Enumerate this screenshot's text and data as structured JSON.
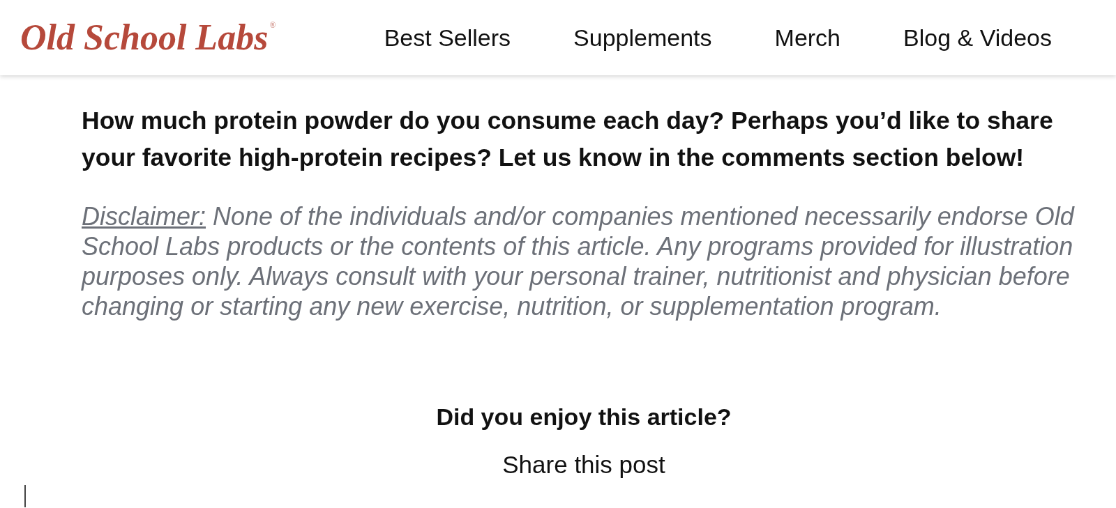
{
  "header": {
    "logo": {
      "text": "Old School Labs",
      "mark": "®"
    },
    "nav": [
      "Best Sellers",
      "Supplements",
      "Merch",
      "Blog & Videos"
    ]
  },
  "article": {
    "call_to_action": "How much protein powder do you consume each day? Perhaps you’d like to share your favorite high-protein recipes? Let us know in the comments section below!",
    "disclaimer": {
      "label": "Disclaimer:",
      "text": "None of the individuals and/or companies mentioned necessarily endorse Old School Labs products or the contents of this article. Any programs provided for illustration purposes only. Always consult with your personal trainer, nutritionist and physician before changing or starting any new exercise, nutrition, or supplementation program."
    }
  },
  "feedback": {
    "question": "Did you enjoy this article?",
    "share_label": "Share this post"
  }
}
